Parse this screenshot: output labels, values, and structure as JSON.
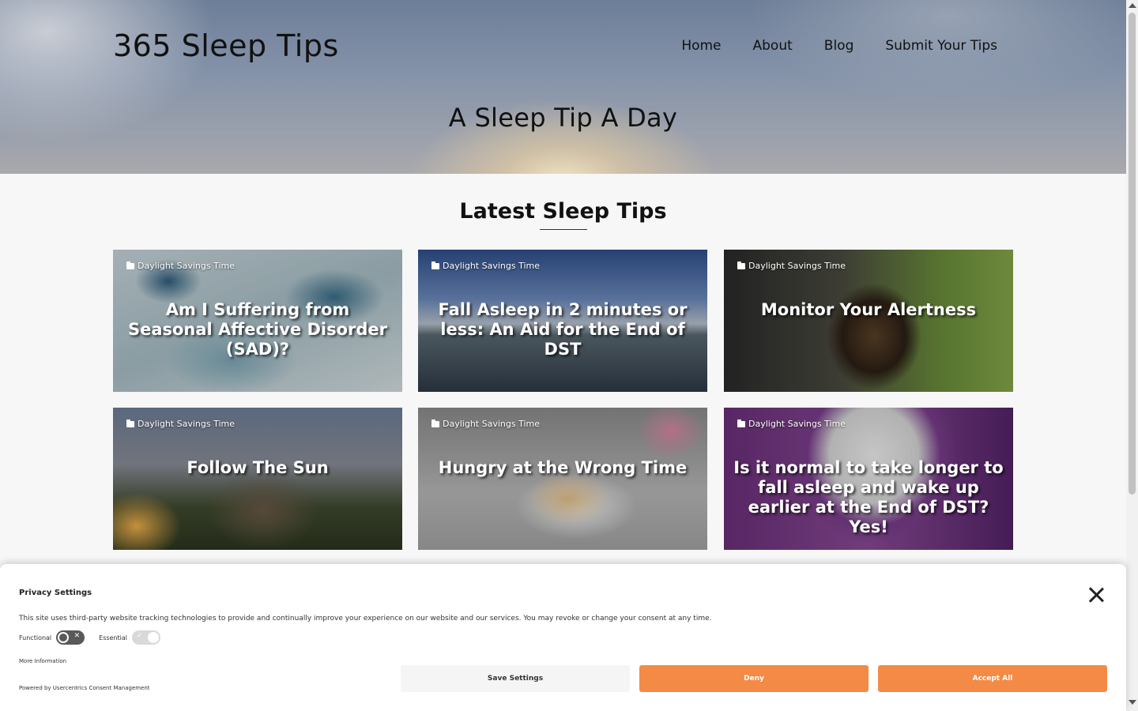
{
  "site": {
    "brand": "365 Sleep Tips",
    "tagline": "A Sleep Tip A Day",
    "nav": [
      "Home",
      "About",
      "Blog",
      "Submit Your Tips"
    ]
  },
  "section": {
    "title": "Latest Sleep Tips"
  },
  "posts": [
    {
      "category": "Daylight Savings Time",
      "title": "Am I Suffering from Seasonal Affective Disorder (SAD)?"
    },
    {
      "category": "Daylight Savings Time",
      "title": "Fall Asleep in 2 minutes or less: An Aid for the End of DST"
    },
    {
      "category": "Daylight Savings Time",
      "title": "Monitor Your Alertness"
    },
    {
      "category": "Daylight Savings Time",
      "title": "Follow The Sun"
    },
    {
      "category": "Daylight Savings Time",
      "title": "Hungry at the Wrong Time"
    },
    {
      "category": "Daylight Savings Time",
      "title": "Is it normal to take longer to fall asleep and wake up earlier at the End of DST? Yes!"
    }
  ],
  "consent": {
    "title": "Privacy Settings",
    "text": "This site uses third-party website tracking technologies to provide and continually improve your experience on our website and our services. You may revoke or change your consent at any time.",
    "toggles": [
      {
        "label": "Functional",
        "state": "off"
      },
      {
        "label": "Essential",
        "state": "on"
      }
    ],
    "more_info": "More Information",
    "powered_by": "Powered by Usercentrics Consent Management",
    "buttons": {
      "save": "Save Settings",
      "deny": "Deny",
      "accept": "Accept All"
    }
  },
  "icons": {
    "category": "folder-icon",
    "close": "close-icon"
  },
  "colors": {
    "accent": "#f38b46",
    "toggle_off": "#595959",
    "toggle_on": "#d9d9d9"
  }
}
